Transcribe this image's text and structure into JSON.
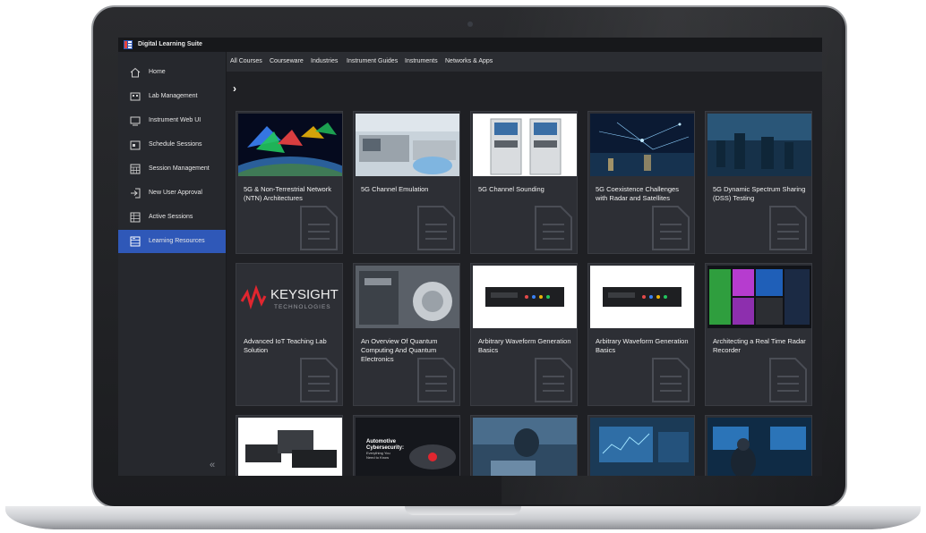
{
  "app": {
    "title": "Digital Learning Suite"
  },
  "sidebar": {
    "items": [
      {
        "label": "Home",
        "icon": "home-icon"
      },
      {
        "label": "Lab Management",
        "icon": "lab-icon"
      },
      {
        "label": "Instrument Web UI",
        "icon": "monitor-icon"
      },
      {
        "label": "Schedule Sessions",
        "icon": "calendar-icon"
      },
      {
        "label": "Session Management",
        "icon": "calendar-grid-icon"
      },
      {
        "label": "New User Approval",
        "icon": "login-icon"
      },
      {
        "label": "Active Sessions",
        "icon": "table-icon"
      },
      {
        "label": "Learning Resources",
        "icon": "resources-icon",
        "active": true
      }
    ],
    "collapse_glyph": "«"
  },
  "topnav": {
    "tabs": [
      "All Courses",
      "Courseware",
      "Industries",
      "Instrument Guides",
      "Instruments",
      "Networks & Apps"
    ]
  },
  "breadcrumb": {
    "chevron": "›"
  },
  "cards": [
    {
      "title": "5G & Non-Terrestrial Network (NTN) Architectures",
      "thumb": "satellites-over-earth"
    },
    {
      "title": "5G Channel Emulation",
      "thumb": "lab-instrument-hands"
    },
    {
      "title": "5G Channel Sounding",
      "thumb": "rack-systems"
    },
    {
      "title": "5G Coexistence Challenges with Radar and Satellites",
      "thumb": "city-network-night"
    },
    {
      "title": "5G Dynamic Spectrum Sharing (DSS) Testing",
      "thumb": "city-skyline-blue"
    },
    {
      "title": "Advanced IoT Teaching Lab Solution",
      "thumb": "keysight-logo",
      "logo_text": "KEYSIGHT",
      "logo_sub": "TECHNOLOGIES"
    },
    {
      "title": "An Overview Of Quantum Computing And Quantum Electronics",
      "thumb": "quantum-lab"
    },
    {
      "title": "Arbitrary Waveform Generation Basics",
      "thumb": "awg-instrument"
    },
    {
      "title": "Arbitrary Waveform Generation Basics",
      "thumb": "awg-instrument"
    },
    {
      "title": "Architecting a Real Time Radar Recorder",
      "thumb": "spectrum-display"
    },
    {
      "title": "",
      "thumb": "instrument-stack"
    },
    {
      "title": "",
      "thumb": "automotive-cyber",
      "overlay_text": "Automotive Cybersecurity: Everything You Need to Know"
    },
    {
      "title": "",
      "thumb": "engineer-screen"
    },
    {
      "title": "",
      "thumb": "monitor-analysis"
    },
    {
      "title": "",
      "thumb": "operator-desk"
    }
  ],
  "colors": {
    "accent": "#2f58b8",
    "background": "#1f2024",
    "sidebar": "#26282d",
    "card": "#2d2f35"
  }
}
